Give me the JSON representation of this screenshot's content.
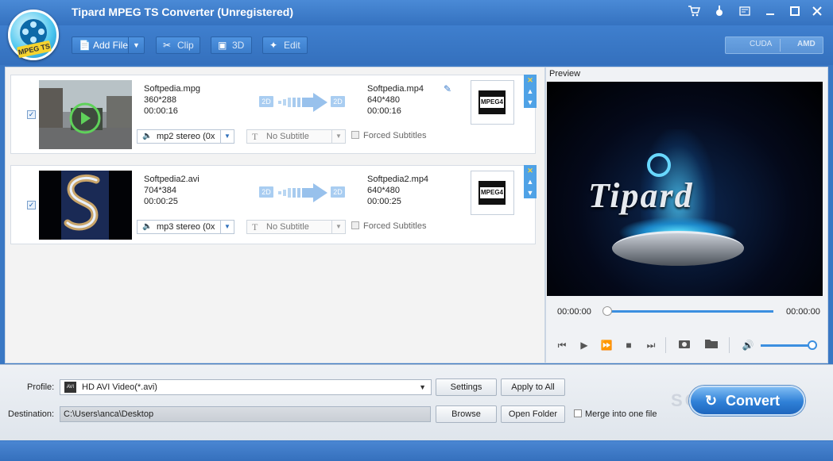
{
  "app": {
    "title": "Tipard MPEG TS Converter (Unregistered)",
    "logo_text": "MPEG TS",
    "titlebar_icons": [
      "cart-icon",
      "key-icon",
      "register-icon",
      "minimize-icon",
      "maximize-icon",
      "close-icon"
    ]
  },
  "toolbar": {
    "add_file": "Add File",
    "clip": "Clip",
    "three_d": "3D",
    "edit": "Edit",
    "cuda": "CUDA",
    "amd": "AMD"
  },
  "files": [
    {
      "source_name": "Softpedia.mpg",
      "source_res": "360*288",
      "source_duration": "00:00:16",
      "output_name": "Softpedia.mp4",
      "output_res": "640*480",
      "output_duration": "00:00:16",
      "audio": "mp2 stereo (0x",
      "subtitle": "No Subtitle",
      "forced": "Forced Subtitles",
      "format_label": "MPEG4",
      "badge_2d": "2D"
    },
    {
      "source_name": "Softpedia2.avi",
      "source_res": "704*384",
      "source_duration": "00:00:25",
      "output_name": "Softpedia2.mp4",
      "output_res": "640*480",
      "output_duration": "00:00:25",
      "audio": "mp3 stereo (0x",
      "subtitle": "No Subtitle",
      "forced": "Forced Subtitles",
      "format_label": "MPEG4",
      "badge_2d": "2D"
    }
  ],
  "preview": {
    "label": "Preview",
    "brand": "Tipard",
    "time_start": "00:00:00",
    "time_end": "00:00:00",
    "seek_position": 0,
    "volume_level": 1.0
  },
  "bottom": {
    "profile_label": "Profile:",
    "profile_value": "HD AVI Video(*.avi)",
    "profile_icon_text": "AVI",
    "destination_label": "Destination:",
    "destination_value": "C:\\Users\\anca\\Desktop",
    "settings": "Settings",
    "apply_all": "Apply to All",
    "browse": "Browse",
    "open_folder": "Open Folder",
    "merge": "Merge into one file",
    "convert": "Convert",
    "watermark": "SOFTPEDIA"
  },
  "colors": {
    "accent": "#3572c0",
    "panel": "#f3f3f3",
    "convert": "#2f80d7"
  }
}
